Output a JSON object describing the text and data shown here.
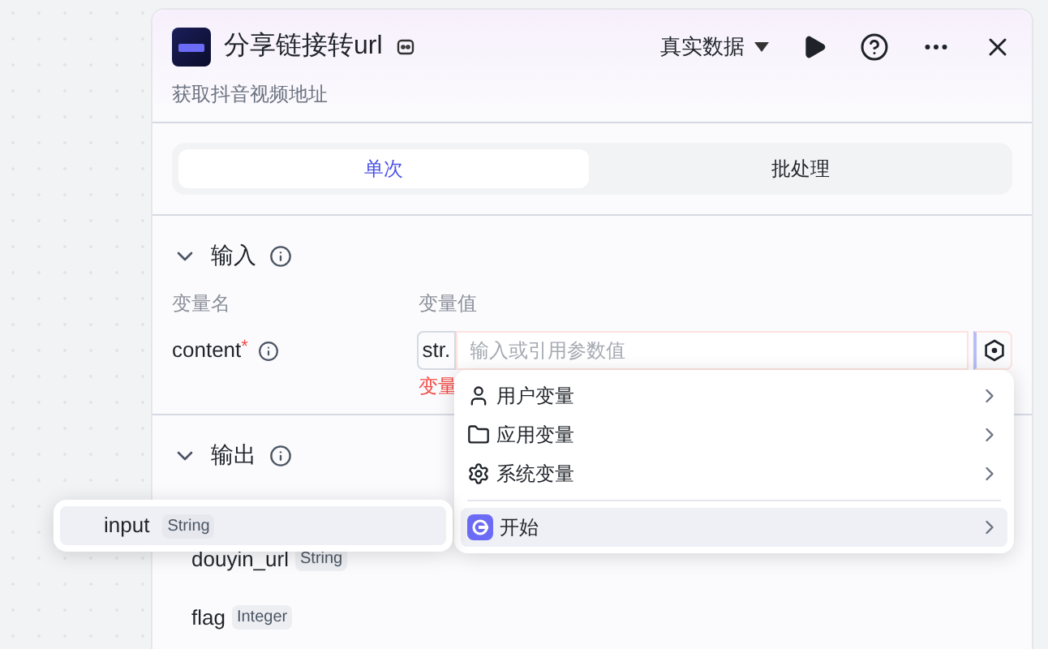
{
  "header": {
    "title": "分享链接转url",
    "subtitle": "获取抖音视频地址",
    "data_source": "真实数据"
  },
  "tabs": [
    {
      "label": "单次",
      "selected": true
    },
    {
      "label": "批处理",
      "selected": false
    }
  ],
  "input_section": {
    "title": "输入",
    "expanded": true,
    "columns": [
      "变量名",
      "变量值"
    ],
    "params": [
      {
        "name": "content",
        "required_mark": "*",
        "type_prefix": "str.",
        "placeholder": "输入或引用参数值",
        "error": "变量"
      }
    ]
  },
  "output_section": {
    "title": "输出",
    "expanded": true,
    "outputs": [
      {
        "name": "douyin_url",
        "type": "String"
      },
      {
        "name": "flag",
        "type": "Integer"
      }
    ]
  },
  "variable_menu": {
    "items": [
      {
        "label": "用户变量",
        "kind": "user",
        "selected": false
      },
      {
        "label": "应用变量",
        "kind": "app",
        "selected": false
      },
      {
        "label": "系统变量",
        "kind": "system",
        "selected": false
      },
      {
        "label": "开始",
        "kind": "node",
        "selected": true
      }
    ]
  },
  "submenu": {
    "items": [
      {
        "name": "input",
        "type": "String",
        "selected": true
      }
    ]
  }
}
